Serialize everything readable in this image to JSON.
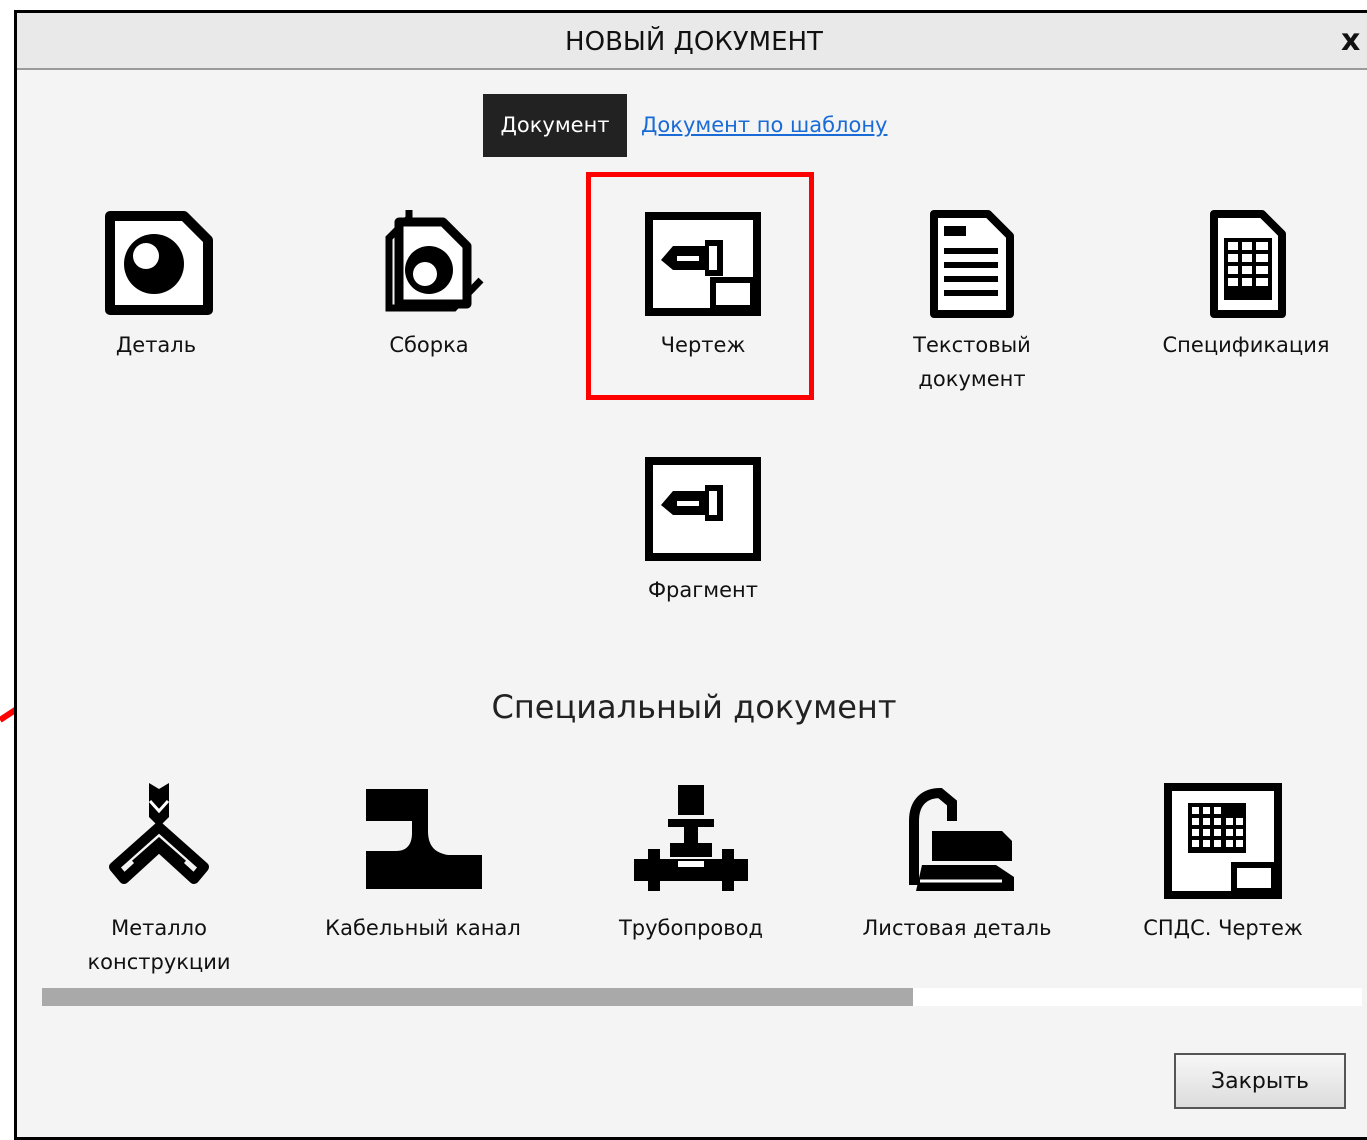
{
  "dialog": {
    "title": "НОВЫЙ ДОКУМЕНТ",
    "close_glyph": "x"
  },
  "tabs": {
    "active": "Документ",
    "link": "Документ по шаблону"
  },
  "documents": [
    {
      "label": "Деталь",
      "icon": "part-icon"
    },
    {
      "label": "Сборка",
      "icon": "assembly-icon"
    },
    {
      "label": "Чертеж",
      "icon": "drawing-icon"
    },
    {
      "label": "Текстовый документ",
      "icon": "text-document-icon"
    },
    {
      "label": "Спецификация",
      "icon": "specification-icon"
    },
    {
      "label": "Фрагмент",
      "icon": "fragment-icon"
    }
  ],
  "special": {
    "heading": "Специальный документ",
    "items": [
      {
        "label": "Металло конструкции",
        "icon": "metal-structures-icon"
      },
      {
        "label": "Кабельный канал",
        "icon": "cable-channel-icon"
      },
      {
        "label": "Трубопровод",
        "icon": "pipeline-icon"
      },
      {
        "label": "Листовая деталь",
        "icon": "sheet-part-icon"
      },
      {
        "label": "СПДС. Чертеж",
        "icon": "spds-drawing-icon"
      }
    ]
  },
  "scrollbar": {
    "visible_fraction": 0.66
  },
  "buttons": {
    "close": "Закрыть"
  },
  "annotation": {
    "color": "#ff0000",
    "highlighted_item": "Чертеж"
  }
}
